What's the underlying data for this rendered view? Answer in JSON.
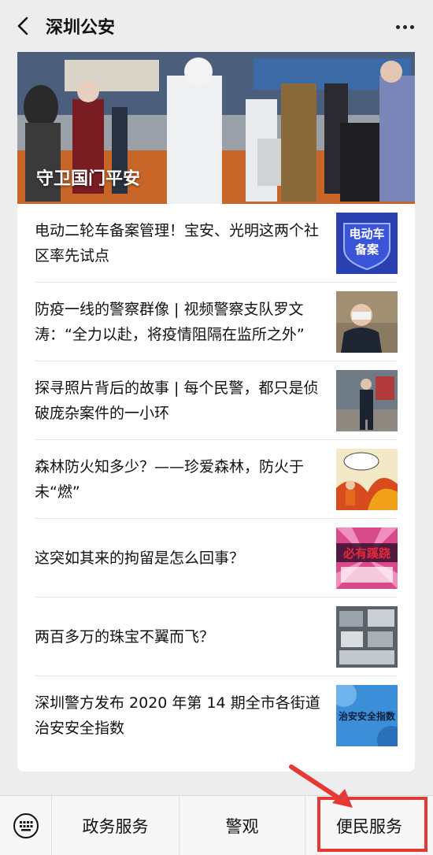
{
  "header": {
    "title": "深圳公安",
    "back_icon": "back-chevron-icon",
    "more_icon": "more-dots-icon"
  },
  "hero": {
    "caption": "守卫国门平安"
  },
  "articles": [
    {
      "title": "电动二轮车备案管理！宝安、光明这两个社区率先试点",
      "thumb_text": "电动车\n备案"
    },
    {
      "title": "防疫一线的警察群像 | 视频警察支队罗文涛：“全力以赴，将疫情阻隔在监所之外”"
    },
    {
      "title": "探寻照片背后的故事 | 每个民警，都只是侦破庞杂案件的一小环"
    },
    {
      "title": "森林防火知多少？——珍爱森林，防火于未“燃”"
    },
    {
      "title": "这突如其来的拘留是怎么回事？",
      "thumb_text": "必有蹊跷"
    },
    {
      "title": "两百多万的珠宝不翼而飞？"
    },
    {
      "title": "深圳警方发布 2020 年第 14 期全市各街道治安安全指数",
      "thumb_text": "治安安全指数"
    }
  ],
  "bottom_menu": {
    "keyboard_icon": "keyboard-icon",
    "items": [
      "政务服务",
      "警观",
      "便民服务"
    ]
  },
  "colors": {
    "highlight": "#e53935"
  }
}
